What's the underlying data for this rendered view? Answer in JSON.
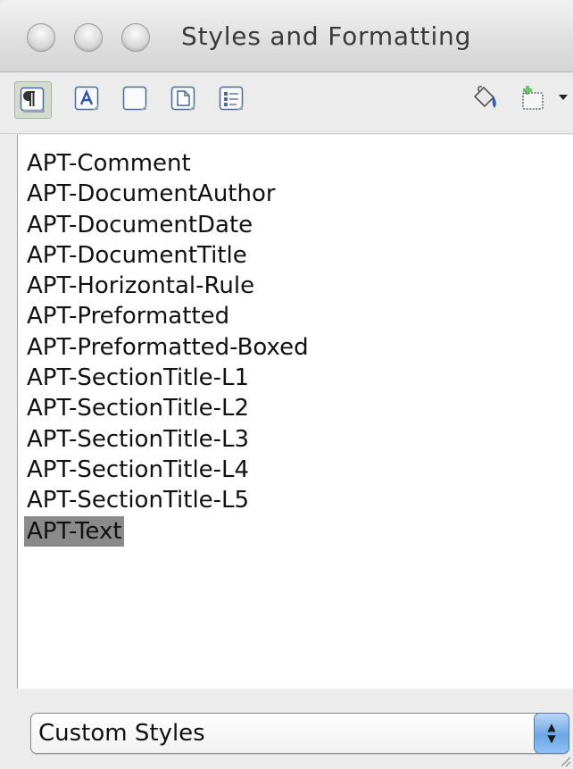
{
  "window": {
    "title": "Styles and Formatting"
  },
  "toolbar": {
    "buttons": [
      {
        "name": "paragraph-styles",
        "icon": "pilcrow-icon",
        "active": true
      },
      {
        "name": "character-styles",
        "icon": "character-a-icon",
        "active": false
      },
      {
        "name": "frame-styles",
        "icon": "frame-icon",
        "active": false
      },
      {
        "name": "page-styles",
        "icon": "page-icon",
        "active": false
      },
      {
        "name": "list-styles",
        "icon": "list-icon",
        "active": false
      },
      {
        "name": "fill-format-mode",
        "icon": "paint-bucket-icon",
        "active": false
      },
      {
        "name": "new-style-from-selection",
        "icon": "new-style-icon",
        "active": false
      }
    ]
  },
  "styles": {
    "items": [
      "APT-Comment",
      "APT-DocumentAuthor",
      "APT-DocumentDate",
      "APT-DocumentTitle",
      "APT-Horizontal-Rule",
      "APT-Preformatted",
      "APT-Preformatted-Boxed",
      "APT-SectionTitle-L1",
      "APT-SectionTitle-L2",
      "APT-SectionTitle-L3",
      "APT-SectionTitle-L4",
      "APT-SectionTitle-L5",
      "APT-Text"
    ],
    "selected": "APT-Text"
  },
  "filter": {
    "value": "Custom Styles"
  },
  "colors": {
    "selection": "#8a8a8a",
    "stepper_accent": "#6ca6e6",
    "active_tool": "#d5dccf"
  }
}
